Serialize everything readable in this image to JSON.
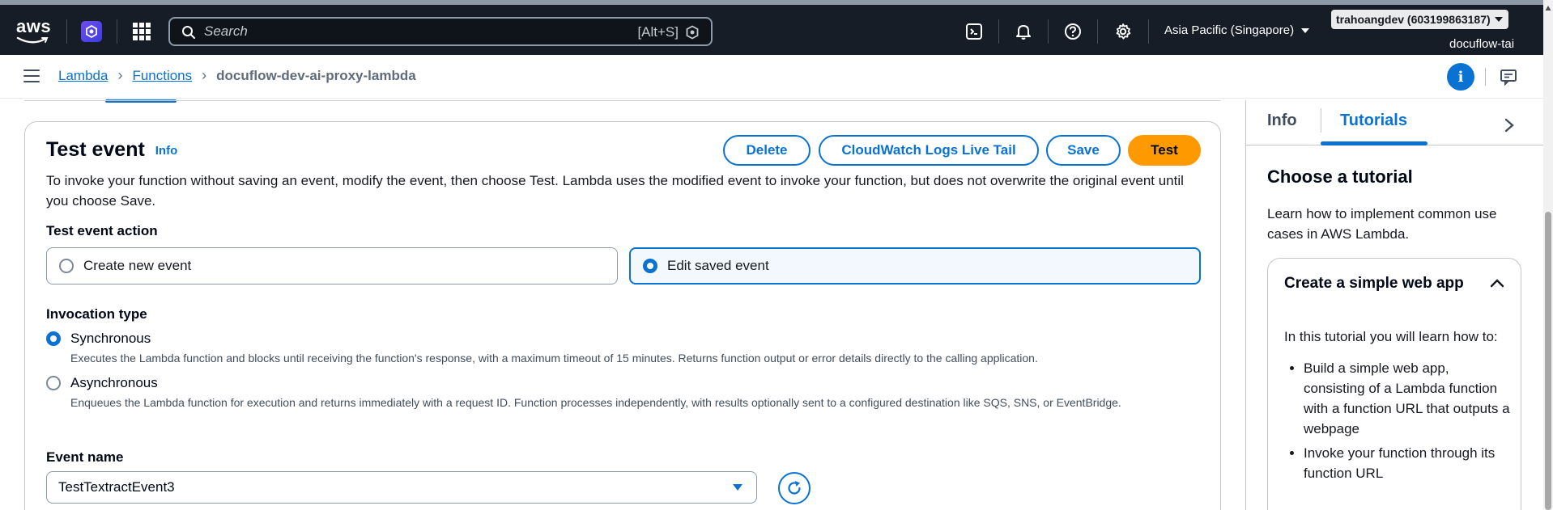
{
  "topnav": {
    "logo": "aws",
    "search_placeholder": "Search",
    "search_shortcut": "[Alt+S]",
    "region": "Asia Pacific (Singapore)",
    "account": "trahoangdev (603199863187)",
    "account_sub": "docuflow-tai"
  },
  "breadcrumb": {
    "items": [
      "Lambda",
      "Functions"
    ],
    "current": "docuflow-dev-ai-proxy-lambda"
  },
  "test_event": {
    "title": "Test event",
    "info_link": "Info",
    "buttons": {
      "delete": "Delete",
      "cloudwatch": "CloudWatch Logs Live Tail",
      "save": "Save",
      "test": "Test"
    },
    "description": "To invoke your function without saving an event, modify the event, then choose Test. Lambda uses the modified event to invoke your function, but does not overwrite the original event until you choose Save.",
    "action_label": "Test event action",
    "action_options": {
      "create": "Create new event",
      "edit": "Edit saved event"
    },
    "invocation_label": "Invocation type",
    "invocation": {
      "sync_label": "Synchronous",
      "sync_desc": "Executes the Lambda function and blocks until receiving the function's response, with a maximum timeout of 15 minutes. Returns function output or error details directly to the calling application.",
      "async_label": "Asynchronous",
      "async_desc": "Enqueues the Lambda function for execution and returns immediately with a request ID. Function processes independently, with results optionally sent to a configured destination like SQS, SNS, or EventBridge."
    },
    "event_name_label": "Event name",
    "event_name_value": "TestTextractEvent3"
  },
  "side_panel": {
    "tabs": [
      "Info",
      "Tutorials"
    ],
    "active_tab": "Tutorials",
    "title": "Choose a tutorial",
    "subtitle": "Learn how to implement common use cases in AWS Lambda.",
    "card": {
      "title": "Create a simple web app",
      "intro": "In this tutorial you will learn how to:",
      "bullets": [
        "Build a simple web app, consisting of a Lambda function with a function URL that outputs a webpage",
        "Invoke your function through its function URL"
      ]
    }
  },
  "colors": {
    "nav_bg": "#161d26",
    "link": "#0972d3",
    "primary_button": "#ff9900"
  }
}
